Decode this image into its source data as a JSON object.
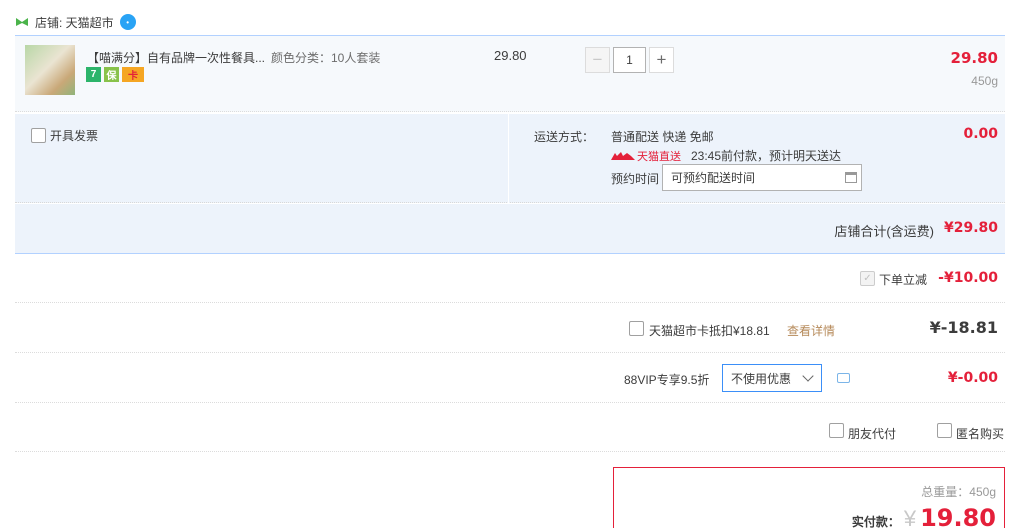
{
  "shop": {
    "label": "店铺: 天猫超市",
    "icon": "wangwang-chat-icon"
  },
  "item": {
    "title": "【喵满分】自有品牌一次性餐具...",
    "sku": "颜色分类：10人套装",
    "tags": [
      "7",
      "保",
      "卡"
    ],
    "unit_price": "29.80",
    "quantity": "1",
    "subtotal": "29.80",
    "weight": "450g"
  },
  "service": {
    "invoice_label": "开具发票",
    "shipping_label": "运送方式：",
    "shipping_value": "普通配送 快递 免邮",
    "tmall_badge": "天猫直送",
    "delivery_note": "23:45前付款，预计明天送达",
    "schedule_label": "预约时间",
    "schedule_placeholder": "可预约配送时间",
    "shipping_fee": "0.00"
  },
  "shop_total": {
    "label": "店铺合计(含运费)",
    "value": "¥29.80"
  },
  "discounts": {
    "instant_label": "下单立减",
    "instant_value": "-¥10.00",
    "card_label": "天猫超市卡抵扣¥18.81",
    "card_link": "查看详情",
    "card_value": "¥-18.81",
    "vip_label": "88VIP专享9.5折",
    "vip_select": "不使用优惠",
    "vip_value": "¥-0.00"
  },
  "options": {
    "friend_pay": "朋友代付",
    "anonymous": "匿名购买"
  },
  "payment": {
    "weight_label": "总重量：450g",
    "pay_label": "实付款：",
    "currency": "¥",
    "amount": "19.80"
  },
  "colors": {
    "price_red": "#e4203a",
    "border_blue": "#b2d1ff",
    "panel_bg": "#edf3fb"
  }
}
